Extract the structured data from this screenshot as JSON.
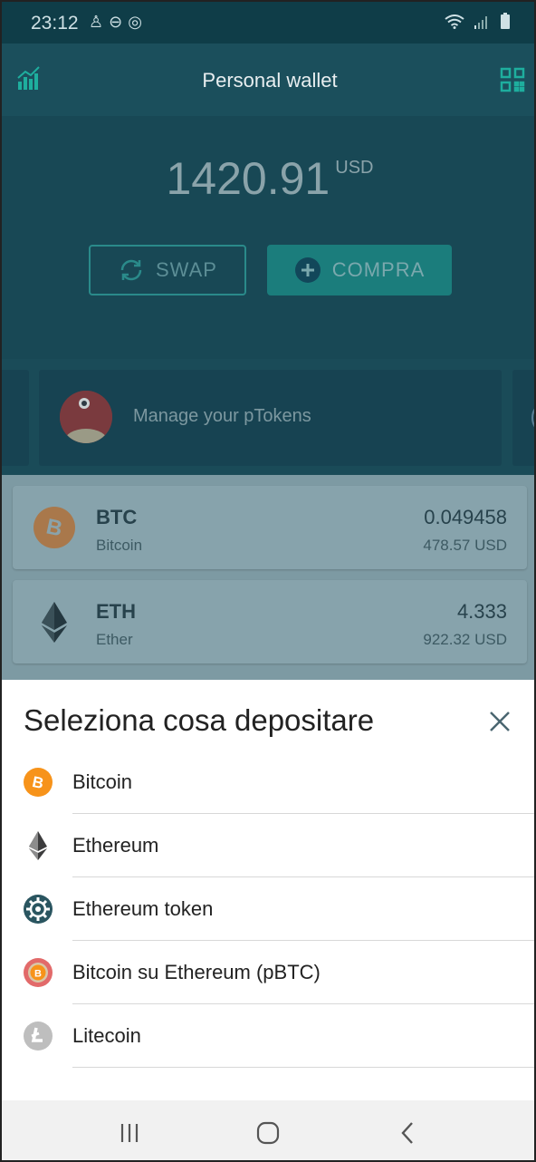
{
  "status_bar": {
    "time": "23:12",
    "left_icons": [
      "person-icon",
      "do-not-disturb-icon",
      "spiral-icon"
    ],
    "right_icons": [
      "wifi-icon",
      "signal-icon",
      "battery-icon"
    ]
  },
  "app_bar": {
    "title": "Personal wallet",
    "left_icon": "chart-icon",
    "right_icon": "qr-code-icon"
  },
  "balance": {
    "amount": "1420.91",
    "currency": "USD"
  },
  "actions": {
    "swap_label": "SWAP",
    "buy_label": "COMPRA"
  },
  "ptokens_card": {
    "label": "Manage your pTokens"
  },
  "coins": [
    {
      "symbol": "BTC",
      "name": "Bitcoin",
      "quantity": "0.049458",
      "usd": "478.57 USD",
      "icon": "bitcoin-icon"
    },
    {
      "symbol": "ETH",
      "name": "Ether",
      "quantity": "4.333",
      "usd": "922.32 USD",
      "icon": "ethereum-icon"
    }
  ],
  "sheet": {
    "title": "Seleziona cosa depositare",
    "options": [
      {
        "label": "Bitcoin",
        "icon": "bitcoin-icon"
      },
      {
        "label": "Ethereum",
        "icon": "ethereum-icon"
      },
      {
        "label": "Ethereum token",
        "icon": "token-gear-icon"
      },
      {
        "label": "Bitcoin su Ethereum (pBTC)",
        "icon": "pbtc-icon"
      },
      {
        "label": "Litecoin",
        "icon": "litecoin-icon"
      }
    ]
  },
  "colors": {
    "bitcoin": "#f7931a",
    "accent": "#1b7d7c",
    "sheet_text": "#222222"
  }
}
